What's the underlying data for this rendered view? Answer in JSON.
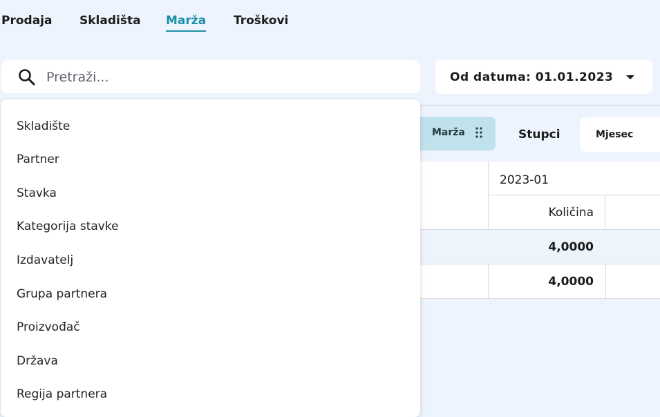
{
  "tabs": [
    {
      "label": "Prodaja"
    },
    {
      "label": "Skladišta"
    },
    {
      "label": "Marža",
      "active": true
    },
    {
      "label": "Troškovi"
    }
  ],
  "search": {
    "placeholder": "Pretraži..."
  },
  "date_filter": {
    "label": "Od datuma: 01.01.2023"
  },
  "pivot": {
    "row_chip": "Marža",
    "columns_label": "Stupci",
    "column_field": "Mjesec",
    "header_period": "2023-01",
    "header_measure": "Količina",
    "rows": [
      {
        "value": "4,0000"
      },
      {
        "value": "4,0000"
      }
    ]
  },
  "dropdown": {
    "items": [
      "Skladište",
      "Partner",
      "Stavka",
      "Kategorija stavke",
      "Izdavatelj",
      "Grupa partnera",
      "Proizvođač",
      "Država",
      "Regija partnera"
    ]
  },
  "colors": {
    "background": "#edf4fd",
    "accent": "#1a8fa7",
    "chip": "#bfe2ec"
  }
}
